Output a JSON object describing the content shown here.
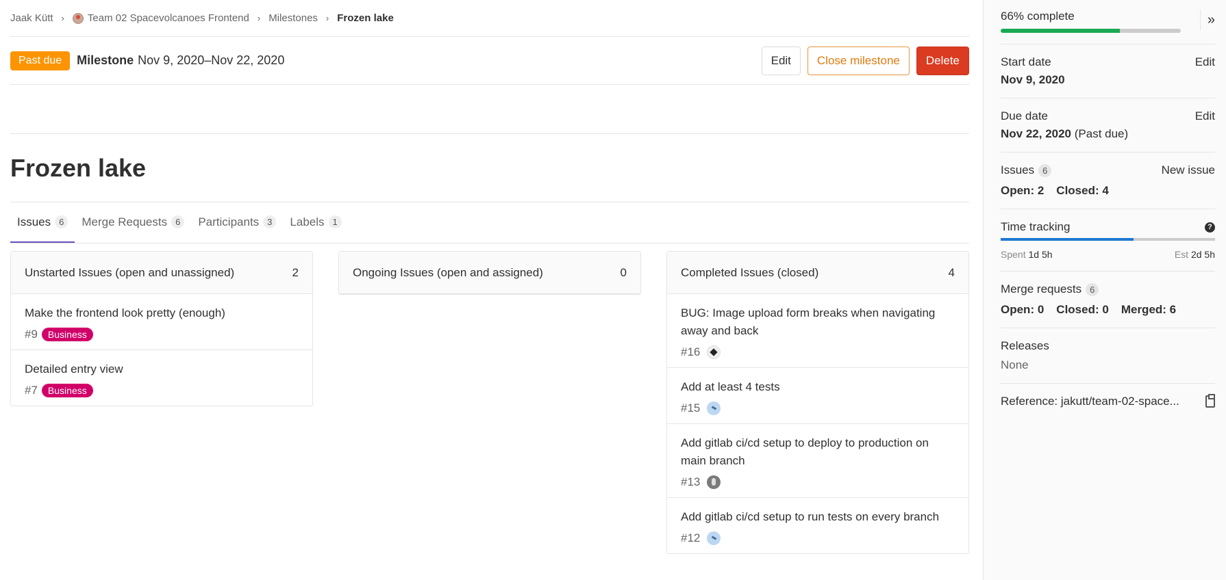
{
  "breadcrumb": {
    "user": "Jaak Kütt",
    "project": "Team 02 Spacevolcanoes Frontend",
    "section": "Milestones",
    "current": "Frozen lake"
  },
  "header": {
    "status_badge": "Past due",
    "milestone_label": "Milestone",
    "dates": "Nov 9, 2020–Nov 22, 2020",
    "edit_label": "Edit",
    "close_label": "Close milestone",
    "delete_label": "Delete"
  },
  "title": "Frozen lake",
  "tabs": [
    {
      "label": "Issues",
      "count": "6"
    },
    {
      "label": "Merge Requests",
      "count": "6"
    },
    {
      "label": "Participants",
      "count": "3"
    },
    {
      "label": "Labels",
      "count": "1"
    }
  ],
  "boards": {
    "unstarted": {
      "title": "Unstarted Issues (open and unassigned)",
      "count": "2",
      "issues": [
        {
          "title": "Make the frontend look pretty (enough)",
          "ref": "#9",
          "label": "Business"
        },
        {
          "title": "Detailed entry view",
          "ref": "#7",
          "label": "Business"
        }
      ]
    },
    "ongoing": {
      "title": "Ongoing Issues (open and assigned)",
      "count": "0"
    },
    "completed": {
      "title": "Completed Issues (closed)",
      "count": "4",
      "issues": [
        {
          "title": "BUG: Image upload form breaks when navigating away and back",
          "ref": "#16"
        },
        {
          "title": "Add at least 4 tests",
          "ref": "#15"
        },
        {
          "title": "Add gitlab ci/cd setup to deploy to production on main branch",
          "ref": "#13"
        },
        {
          "title": "Add gitlab ci/cd setup to run tests on every branch",
          "ref": "#12"
        }
      ]
    }
  },
  "sidebar": {
    "complete_text": "66% complete",
    "complete_value": 0.66,
    "start_date": {
      "label": "Start date",
      "edit": "Edit",
      "value": "Nov 9, 2020"
    },
    "due_date": {
      "label": "Due date",
      "edit": "Edit",
      "value": "Nov 22, 2020",
      "note": "(Past due)"
    },
    "issues": {
      "label": "Issues",
      "count": "6",
      "new_issue": "New issue",
      "open": "Open: 2",
      "closed": "Closed: 4"
    },
    "time_tracking": {
      "label": "Time tracking",
      "spent_label": "Spent",
      "spent": "1d 5h",
      "est_label": "Est",
      "est": "2d 5h",
      "ratio": 0.62
    },
    "merge_requests": {
      "label": "Merge requests",
      "count": "6",
      "open": "Open: 0",
      "closed": "Closed: 0",
      "merged": "Merged: 6"
    },
    "releases": {
      "label": "Releases",
      "value": "None"
    },
    "reference": "Reference: jakutt/team-02-space..."
  },
  "colors": {
    "past_due": "#fc9403",
    "delete": "#db3b21",
    "label_business": "#d10069",
    "progress": "#1aaa55",
    "time_tracking": "#1f78d1",
    "active_tab": "#6b4fbb"
  }
}
